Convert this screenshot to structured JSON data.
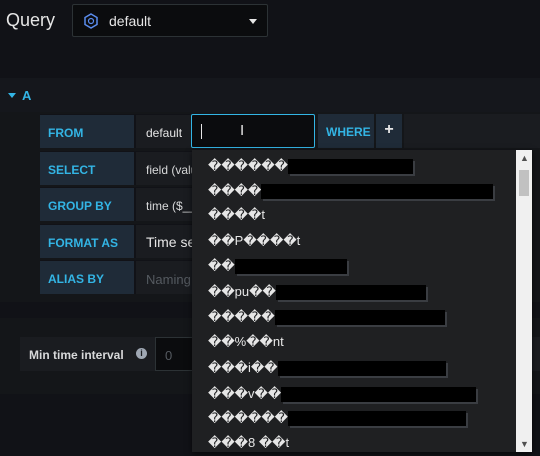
{
  "query_label": "Query",
  "datasource": {
    "name": "default",
    "icon": "influxdb-icon"
  },
  "row": {
    "label": "A"
  },
  "segments": {
    "from_label": "FROM",
    "from_value": "default",
    "where_label": "WHERE",
    "plus_label": "+",
    "select_label": "SELECT",
    "select_value": "field (valu",
    "groupby_label": "GROUP BY",
    "groupby_value": "time ($__",
    "format_label": "FORMAT AS",
    "format_value": "Time se",
    "alias_label": "ALIAS BY",
    "alias_placeholder": "Naming"
  },
  "interval": {
    "label": "Min time interval",
    "value": "0"
  },
  "dropdown_items": [
    "������",
    "����",
    "����t",
    " ��P����t",
    "��",
    "��pu��",
    "�����",
    "��%��nt",
    "���i��",
    "���v��",
    "������",
    "���8 ��t"
  ]
}
